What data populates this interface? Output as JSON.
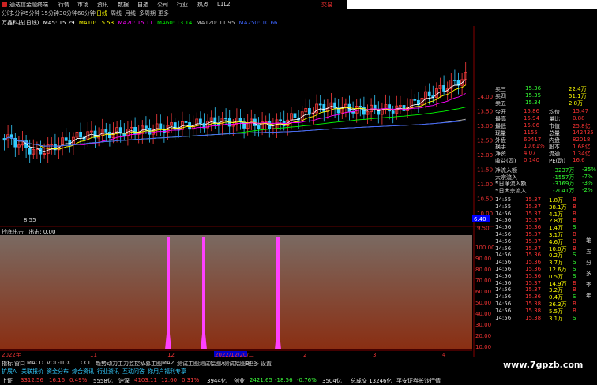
{
  "window": {
    "title": "通达信金融终端",
    "brand": "交易"
  },
  "menu": [
    "行情",
    "市场",
    "资讯",
    "数据",
    "自选",
    "公司",
    "行业",
    "热点",
    "L1L2"
  ],
  "toolbar": [
    "分时",
    "1分钟",
    "5分钟",
    "15分钟",
    "30分钟",
    "60分钟",
    "日线",
    "周线",
    "月线",
    "多周期",
    "更多"
  ],
  "ma": {
    "stock": "万鑫科技(日线)",
    "ma5": "MA5: 15.29",
    "ma10": "MA10: 15.53",
    "ma20": "MA20: 15.11",
    "ma60": "MA60: 13.14",
    "ma120": "MA120: 11.95",
    "extra": "MA250: 10.66"
  },
  "axis": {
    "price_labels": [
      "14.00",
      "13.50",
      "13.00",
      "12.50",
      "12.00",
      "11.50",
      "11.00",
      "10.50",
      "10.00",
      "9.50"
    ],
    "low_mark": "8.55",
    "cur_mark": "6.40",
    "ind_labels": [
      "100.00",
      "90.00",
      "80.00",
      "70.00",
      "60.00",
      "50.00",
      "40.00",
      "30.00",
      "20.00",
      "10.00"
    ],
    "dates": [
      "2022年",
      "11",
      "12",
      "2022/12/20/二",
      "2",
      "3",
      "4"
    ]
  },
  "indicator": {
    "name": "抄底出击",
    "label": "出击:",
    "value": "0.00"
  },
  "quote": {
    "ask": [
      {
        "k": "卖三",
        "p": "15.36",
        "v": "22.4万"
      },
      {
        "k": "卖四",
        "p": "15.35",
        "v": "51.1万"
      },
      {
        "k": "卖五",
        "p": "15.34",
        "v": "2.8万"
      }
    ],
    "stats": [
      {
        "k": "今开",
        "v": "15.86",
        "k2": "均价",
        "v2": "15.47"
      },
      {
        "k": "最高",
        "v": "15.94",
        "k2": "量比",
        "v2": "0.88"
      },
      {
        "k": "最低",
        "v": "15.06",
        "k2": "市值",
        "v2": "25.8亿"
      },
      {
        "k": "现量",
        "v": "1155",
        "k2": "总量",
        "v2": "142435"
      },
      {
        "k": "外盘",
        "v": "60417",
        "k2": "内盘",
        "v2": "82018"
      },
      {
        "k": "换手",
        "v": "10.61%",
        "k2": "股本",
        "v2": "1.68亿"
      },
      {
        "k": "净资",
        "v": "4.07",
        "k2": "流通",
        "v2": "1.34亿"
      },
      {
        "k": "收益(四)",
        "v": "0.140",
        "k2": "PE(动)",
        "v2": "16.6"
      }
    ],
    "flows": [
      {
        "k": "净流入额",
        "v": "-3237万",
        "p": "-35%"
      },
      {
        "k": "大宗流入",
        "v": "-1557万",
        "p": "-7%"
      },
      {
        "k": "5日净流入额",
        "v": "-3169万",
        "p": "-3%"
      },
      {
        "k": "5日大宗流入",
        "v": "-2041万",
        "p": "-2%"
      }
    ],
    "ticks": [
      {
        "t": "14:55",
        "p": "15.37",
        "v": "1.8万",
        "d": "B"
      },
      {
        "t": "14:55",
        "p": "15.37",
        "v": "38.1万",
        "d": "B"
      },
      {
        "t": "14:56",
        "p": "15.37",
        "v": "4.1万",
        "d": "B"
      },
      {
        "t": "14:56",
        "p": "15.37",
        "v": "2.8万",
        "d": "B"
      },
      {
        "t": "14:56",
        "p": "15.36",
        "v": "1.4万",
        "d": "S"
      },
      {
        "t": "14:56",
        "p": "15.37",
        "v": "3.1万",
        "d": "B"
      },
      {
        "t": "14:56",
        "p": "15.37",
        "v": "4.6万",
        "d": "B"
      },
      {
        "t": "14:56",
        "p": "15.37",
        "v": "10.0万",
        "d": "B"
      },
      {
        "t": "14:56",
        "p": "15.36",
        "v": "0.2万",
        "d": "S"
      },
      {
        "t": "14:56",
        "p": "15.36",
        "v": "3.7万",
        "d": "S"
      },
      {
        "t": "14:56",
        "p": "15.36",
        "v": "12.6万",
        "d": "S"
      },
      {
        "t": "14:56",
        "p": "15.36",
        "v": "0.5万",
        "d": "S"
      },
      {
        "t": "14:56",
        "p": "15.37",
        "v": "14.9万",
        "d": "B"
      },
      {
        "t": "14:56",
        "p": "15.37",
        "v": "3.2万",
        "d": "B"
      },
      {
        "t": "14:56",
        "p": "15.36",
        "v": "0.4万",
        "d": "S"
      },
      {
        "t": "14:56",
        "p": "15.38",
        "v": "26.3万",
        "d": "B"
      },
      {
        "t": "14:56",
        "p": "15.38",
        "v": "5.5万",
        "d": "B"
      },
      {
        "t": "14:56",
        "p": "15.38",
        "v": "3.1万",
        "d": "S"
      }
    ]
  },
  "right_tabs": [
    "笔",
    "五",
    "分",
    "多",
    "季",
    "年"
  ],
  "bottom_tabs": [
    "指标",
    "窗口",
    "MACD",
    "VOL-TDX",
    "CCI",
    "趋势动力",
    "主力监控",
    "私募主图",
    "MA2",
    "测试主图",
    "测试幅图A",
    "测试幅图B",
    "更多",
    "设置"
  ],
  "bottom_tabs2": [
    "扩展A",
    "关联报价",
    "资金分布",
    "综合资讯",
    "行业资讯",
    "互动问答",
    "你用户福利专享"
  ],
  "status": {
    "sh": {
      "name": "上证",
      "v": "3312.56",
      "c": "16.16",
      "p": "0.49%",
      "amt": "5558亿"
    },
    "hs": {
      "name": "沪深",
      "v": "4103.11",
      "c": "12.60",
      "p": "0.31%",
      "amt": "3944亿"
    },
    "cy": {
      "name": "创业",
      "v": "2421.65",
      "c": "-18.56",
      "p": "-0.76%",
      "amt": "3504亿"
    },
    "total": "总成交 13246亿",
    "news": "平安证券长沙行情"
  },
  "watermark": "www.7gpzb.com",
  "colors": {
    "up": "#ff3c3c",
    "down": "#3cff3c",
    "ma5": "#ffffff",
    "ma10": "#ffff00",
    "ma20": "#ff00ff",
    "ma60": "#00ff00",
    "ma120": "#c0c0c0",
    "ma250": "#3c64ff",
    "signal": "#ff40ff"
  }
}
